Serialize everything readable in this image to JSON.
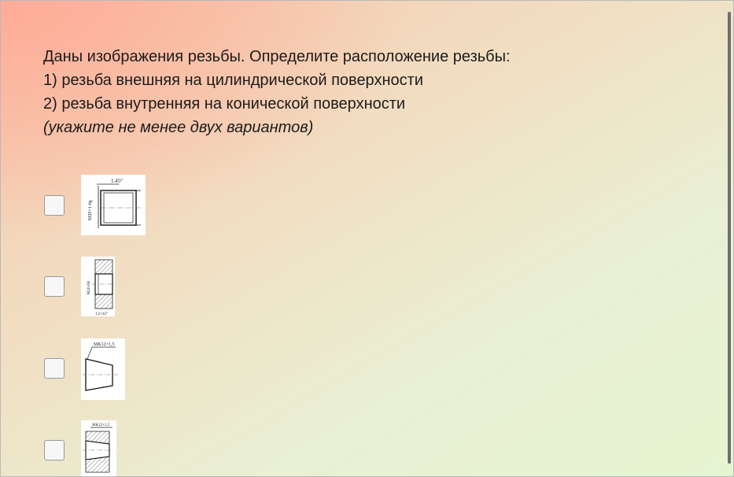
{
  "question": {
    "lines": [
      "Даны изображения резьбы. Определите расположение резьбы:",
      "1) резьба внешняя на цилиндрической поверхности",
      "2) резьба внутренняя на конической поверхности"
    ],
    "note": "(укажите  не менее двух вариантов)"
  },
  "options": [
    {
      "checked": false,
      "image_labels": {
        "top": "1.45°",
        "side": "M20×1-6g"
      }
    },
    {
      "checked": false,
      "image_labels": {
        "side": "M20-6H",
        "bottom": "1,5×45°"
      }
    },
    {
      "checked": false,
      "image_labels": {
        "top": "MK12×1,5"
      }
    },
    {
      "checked": false,
      "image_labels": {
        "top": "MK12×1,5"
      }
    }
  ]
}
